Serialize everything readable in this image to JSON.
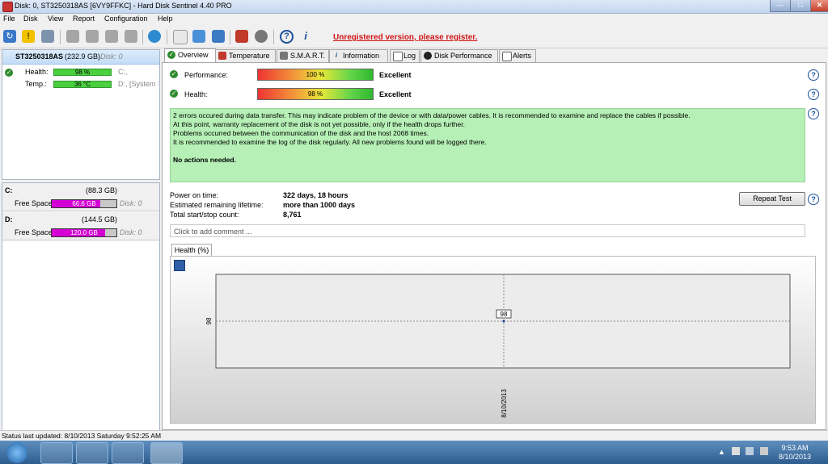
{
  "window": {
    "title": "Disk: 0, ST3250318AS [6VY9FFKC]  -  Hard Disk Sentinel 4.40 PRO"
  },
  "menu": [
    "File",
    "Disk",
    "View",
    "Report",
    "Configuration",
    "Help"
  ],
  "toolbar": {
    "icons": [
      "refresh-icon",
      "warning-icon",
      "disk-icon",
      "sensor-icon",
      "sensor2-icon",
      "sensor3-icon",
      "sensor4-icon",
      "globe-icon",
      "document-icon",
      "copy-icon",
      "network-icon",
      "chart-icon",
      "speaker-icon",
      "help-icon",
      "info-icon"
    ],
    "register_text": "Unregistered version, please register."
  },
  "left": {
    "disk_name": "ST3250318AS",
    "disk_size": "(232.9 GB)",
    "disk_index": "Disk: 0",
    "health_label": "Health:",
    "health_value": "98 %",
    "health_drive": "C:,",
    "temp_label": "Temp.:",
    "temp_value": "36 °C",
    "temp_drive": "D:, [System R"
  },
  "volumes": [
    {
      "letter": "C:",
      "size": "(88.3 GB)",
      "free_label": "Free Space",
      "free_value": "66.6 GB",
      "disk": "Disk: 0",
      "fill": 0.75,
      "color": "#d400d4"
    },
    {
      "letter": "D:",
      "size": "(144.5 GB)",
      "free_label": "Free Space",
      "free_value": "120.0 GB",
      "disk": "Disk: 0",
      "fill": 0.83,
      "color": "#d400d4"
    }
  ],
  "tabs": [
    "Overview",
    "Temperature",
    "S.M.A.R.T.",
    "Information",
    "Log",
    "Disk Performance",
    "Alerts"
  ],
  "overview": {
    "performance_label": "Performance:",
    "performance_value": "100 %",
    "performance_rating": "Excellent",
    "health_label": "Health:",
    "health_value": "98 %",
    "health_rating": "Excellent",
    "message_lines": [
      "2 errors occured during data transfer. This may indicate problem of the device or with data/power cables. It is recommended to examine and replace the cables if possible.",
      "At this point, warranty replacement of the disk is not yet possible, only if the health drops further.",
      "Problems occurred between the communication of the disk and the host 2068 times.",
      "It is recommended to examine the log of the disk regularly. All new problems found will be logged there."
    ],
    "actions": "No actions needed.",
    "power_on_label": "Power on time:",
    "power_on_value": "322 days, 18 hours",
    "lifetime_label": "Estimated remaining lifetime:",
    "lifetime_value": "more than 1000 days",
    "startstop_label": "Total start/stop count:",
    "startstop_value": "8,761",
    "repeat_test": "Repeat Test",
    "comment_placeholder": "Click to add comment ..."
  },
  "chart_data": {
    "type": "line",
    "tab_label": "Health (%)",
    "x": [
      "8/10/2013"
    ],
    "series": [
      {
        "values": [
          98
        ]
      }
    ],
    "ytick": "98",
    "point_label": "98"
  },
  "status": {
    "text": "Status last updated: 8/10/2013 Saturday 9:52:25 AM"
  },
  "taskbar": {
    "time": "9:53 AM",
    "date": "8/10/2013"
  }
}
